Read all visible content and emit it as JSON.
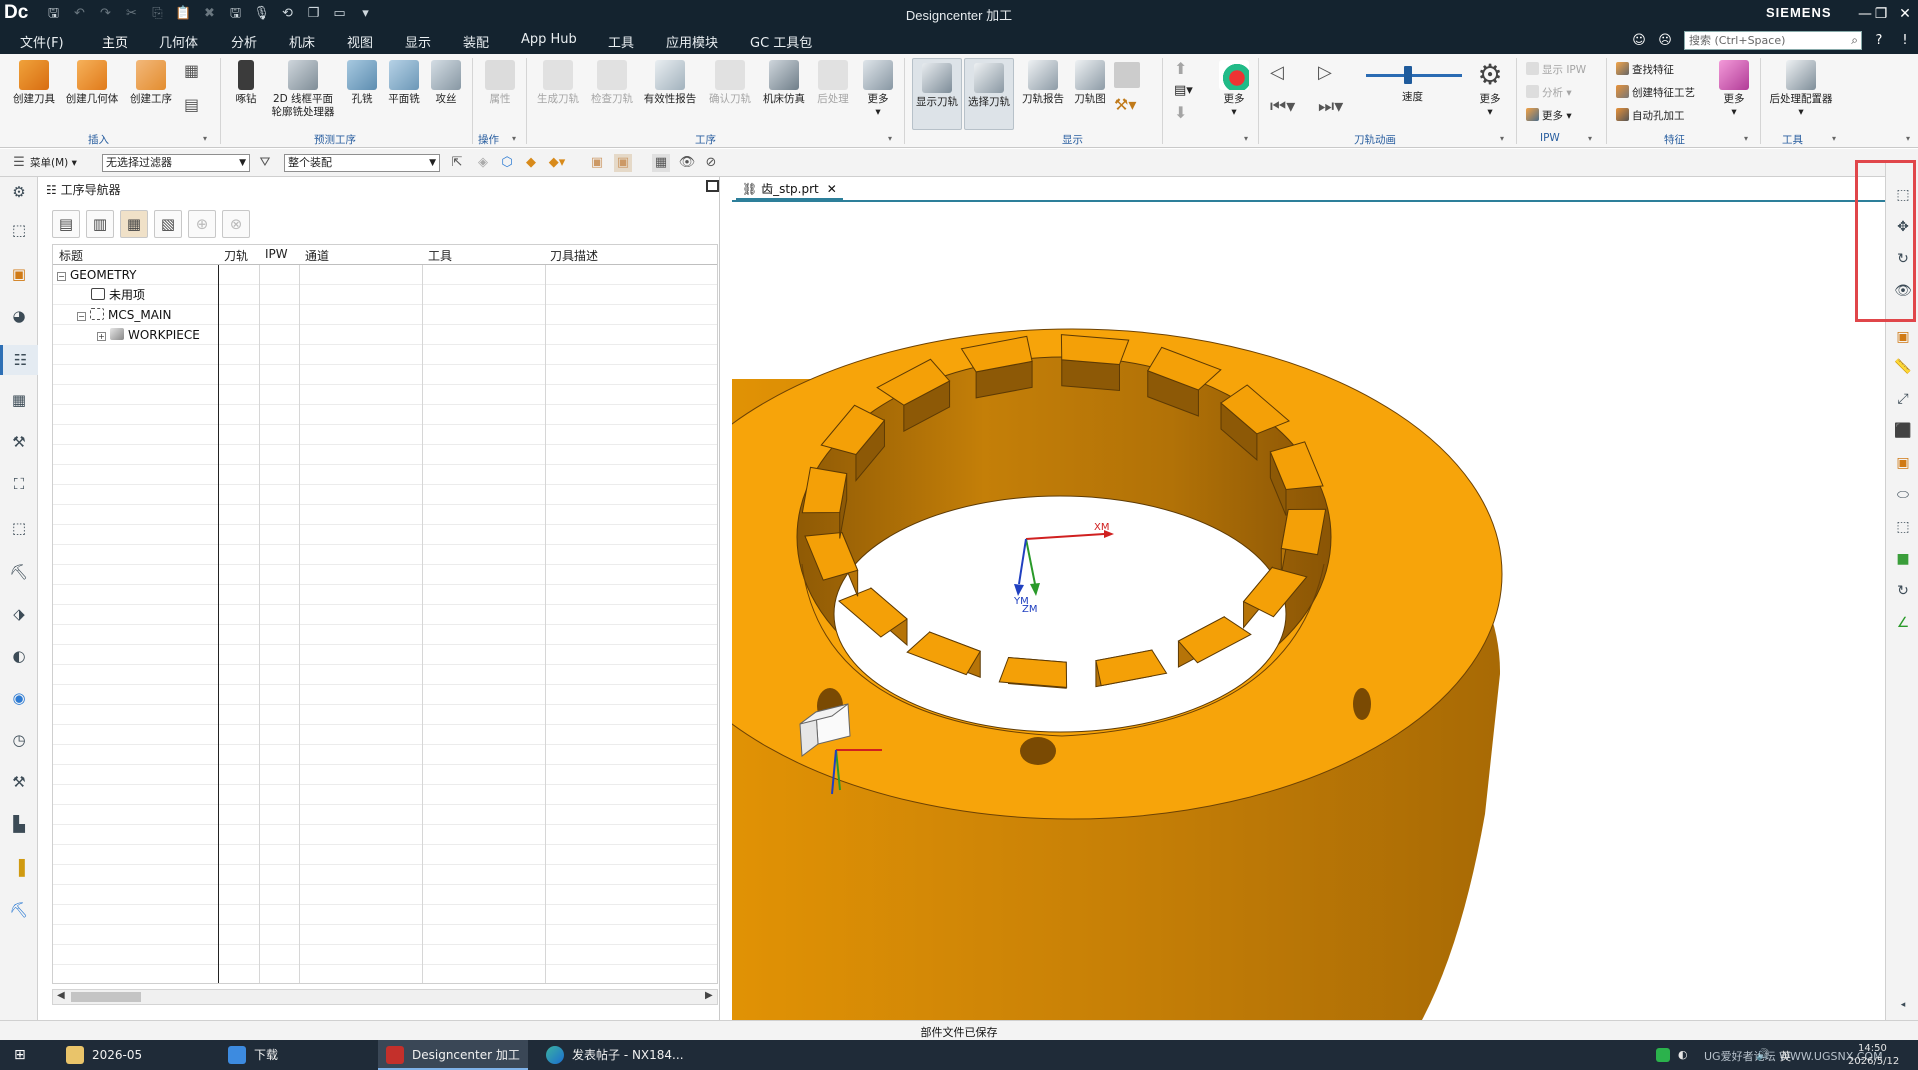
{
  "titlebar": {
    "logo": "Dc",
    "title": "Designcenter 加工",
    "brand": "SIEMENS",
    "min": "—",
    "restore": "❐",
    "close": "✕"
  },
  "menubar": {
    "items": [
      "文件(F)",
      "主页",
      "几何体",
      "分析",
      "机床",
      "视图",
      "显示",
      "装配",
      "App Hub",
      "工具",
      "应用模块",
      "GC 工具包"
    ],
    "active_index": 1,
    "search_placeholder": "搜索 (Ctrl+Space)"
  },
  "ribbon": {
    "insert": {
      "group": "插入",
      "create_tool": "创建刀具",
      "create_geometry": "创建几何体",
      "create_operation": "创建工序"
    },
    "predictive": {
      "group": "预测工序",
      "spot_drill": "啄钻",
      "planar_2d_line1": "2D 线框平面",
      "planar_2d_line2": "轮廓铣处理器",
      "hole_mill": "孔铣",
      "face_mill": "平面铣",
      "tapping": "攻丝"
    },
    "operations": {
      "group": "操作",
      "properties": "属性"
    },
    "process": {
      "group": "工序",
      "generate": "生成刀轨",
      "verify": "检查刀轨",
      "validity_report": "有效性报告",
      "confirm": "确认刀轨",
      "simulation": "机床仿真",
      "postprocess": "后处理",
      "more": "更多"
    },
    "display": {
      "group": "显示",
      "show_toolpath": "显示刀轨",
      "select_toolpath": "选择刀轨",
      "toolpath_report": "刀轨报告",
      "toolpath_graph": "刀轨图",
      "more": "更多"
    },
    "animation": {
      "group": "刀轨动画",
      "speed": "速度",
      "more": "更多"
    },
    "ipw": {
      "group": "IPW",
      "show_ipw": "显示 IPW",
      "analyze": "分析",
      "more": "更多"
    },
    "feature": {
      "group": "特征",
      "find_feature": "查找特征",
      "create_feature_process": "创建特征工艺",
      "auto_hole": "自动孔加工",
      "more": "更多"
    },
    "tools": {
      "group": "工具",
      "post_configurator": "后处理配置器"
    }
  },
  "toolbar2": {
    "menu": "菜单(M)",
    "filter_value": "无选择过滤器",
    "assembly_value": "整个装配"
  },
  "navigator": {
    "title": "工序导航器",
    "columns": [
      "标题",
      "刀轨",
      "IPW",
      "通道",
      "工具",
      "刀具描述"
    ],
    "rows": [
      {
        "label": "GEOMETRY",
        "toggle": "−"
      },
      {
        "label": "未用项",
        "toggle": ""
      },
      {
        "label": "MCS_MAIN",
        "toggle": "−"
      },
      {
        "label": "WORKPIECE",
        "toggle": "+"
      }
    ]
  },
  "viewport": {
    "tab_label": "齿_stp.prt",
    "tab_close": "✕",
    "axis_labels": {
      "xm": "XM",
      "ym": "YM",
      "zm": "ZM"
    },
    "part_color": "#f4a007",
    "part_shadow": "#b67408",
    "part_dark": "#8d5906"
  },
  "status": {
    "message": "部件文件已保存"
  },
  "taskbar": {
    "items": [
      "2026-05",
      "下载",
      "Designcenter 加工",
      "发表帖子 - NX184..."
    ],
    "active_index": 2,
    "clock": "14:50",
    "date": "2026/5/12",
    "ime": "英",
    "watermark": "UG爱好者论坛 WWW.UGSNX.COM"
  }
}
